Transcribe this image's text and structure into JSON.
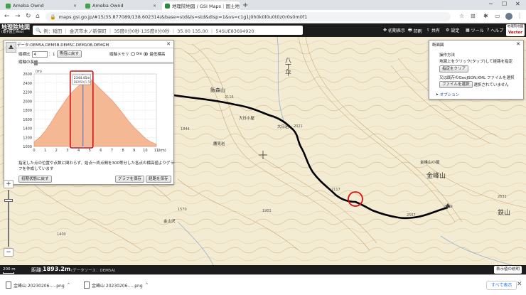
{
  "browser": {
    "tabs": [
      {
        "label": "Ameba Ownd",
        "fav_color": "#3fa34d",
        "active": false
      },
      {
        "label": "Ameba Ownd",
        "fav_color": "#3fa34d",
        "active": false
      },
      {
        "label": "地理院地図 / GSI Maps｜国土地",
        "fav_color": "#2b8a3e",
        "active": true
      }
    ],
    "url": "maps.gsi.go.jp/#15/35.877089/138.602314/&base=std&ls=std&disp=1&vs=c1g1j0h0k0l0u0t0z0r0s0m0f1"
  },
  "gsi": {
    "logo_line1": "地理院地図",
    "logo_line2": "(電子国土Web)",
    "search_text": "例：稲田 ｜ 金沢市木ノ新保町 ｜ 35度0分0秒 135度0分0秒 ｜ 35.00 135.00 ｜ 54SUE83694920",
    "buttons": [
      "初期表示",
      "印刷",
      "共有",
      "設定",
      "ツール",
      "ヘルプ"
    ],
    "vector_line1": "地理院地図",
    "vector_line2": "Vector"
  },
  "profile": {
    "title": "データ:DEM5A,DEM5B,DEM5C,DEM10B,DEMGM",
    "ratio_label": "縦横比",
    "ratio_value": "4",
    "ratio_sep": "：1",
    "equal_btn": "等倍に戻す",
    "memory_label": "縦軸メモリ",
    "opt_0m": "0m",
    "opt_min": "最低標高",
    "length_label": "縦軸の長さ",
    "tooltip_elev": "2344.45m",
    "tooltip_src": "DEM5A(1.5)",
    "desc": "指定した点の位置や点数に関わらず、始点～終点間を300等分した各点の標高値よりグラフを作成しています",
    "reset_btn": "初期状態に戻す",
    "save_graph_btn": "グラフを保存",
    "save_route_btn": "経路を保存"
  },
  "chart_data": {
    "type": "area",
    "title": "",
    "xlabel": "(km)",
    "ylabel": "(m)",
    "ylim": [
      1000,
      2600
    ],
    "xlim": [
      0,
      11
    ],
    "yticks": [
      1000,
      1200,
      1400,
      1600,
      1800,
      2000,
      2200,
      2400,
      2600
    ],
    "xticks": [
      0,
      1,
      2,
      3,
      4,
      5,
      6,
      7,
      8,
      9,
      10,
      11
    ],
    "x": [
      0,
      0.5,
      1,
      1.5,
      2,
      2.5,
      3,
      3.5,
      4,
      4.5,
      5,
      5.5,
      6,
      6.5,
      7,
      7.5,
      8,
      8.5,
      9,
      9.5,
      10,
      10.5,
      11
    ],
    "y": [
      1100,
      1200,
      1340,
      1520,
      1720,
      1900,
      2080,
      2220,
      2340,
      2440,
      2500,
      2380,
      2260,
      2140,
      2020,
      1880,
      1720,
      1560,
      1420,
      1300,
      1180,
      1100,
      1050
    ],
    "marker_x": 4.4,
    "marker_y": 2344.45,
    "fill_color": "#f5b189",
    "stroke_color": "#e08060"
  },
  "operation": {
    "title": "断面図",
    "method_label": "操作方法",
    "line1": "地図上をクリック(タップ)して経路を指定",
    "clear_btn": "指定をクリア",
    "line2": "又は既存のGeoJSON,KML ファイルを選択",
    "file_btn": "ファイルを選択",
    "no_file": "選択されていません",
    "option": "オプション"
  },
  "map_labels": {
    "hachiman": "八丁平",
    "iimori": "飯森山",
    "iimori_elev": "2116",
    "odarumi": "大日小屋",
    "odarumi2": "大日岩",
    "takami": "鷹見岩",
    "kinpu": "金峰山",
    "kinpu_hut": "金峰山小屋",
    "tetsu": "鉄山",
    "kin_river": "金山沢",
    "e1844": "1844",
    "e2021": "2021",
    "e2117": "2117",
    "e1570": "1570",
    "e1901": "1901",
    "e2599": "2599",
    "e2567": "2567",
    "e2631": "2631",
    "e1400": "1400"
  },
  "status": {
    "scale": "200 m",
    "length_label": "距離:",
    "length_value": "1893.2m",
    "source": "(データソース：DEM5A)",
    "legend_btn": "表示値の説明"
  },
  "downloads": [
    {
      "label": "金峰山 20230206-....png"
    },
    {
      "label": "金峰山 20230206-....png"
    }
  ],
  "download_bar": {
    "show_all": "すべて表示"
  }
}
